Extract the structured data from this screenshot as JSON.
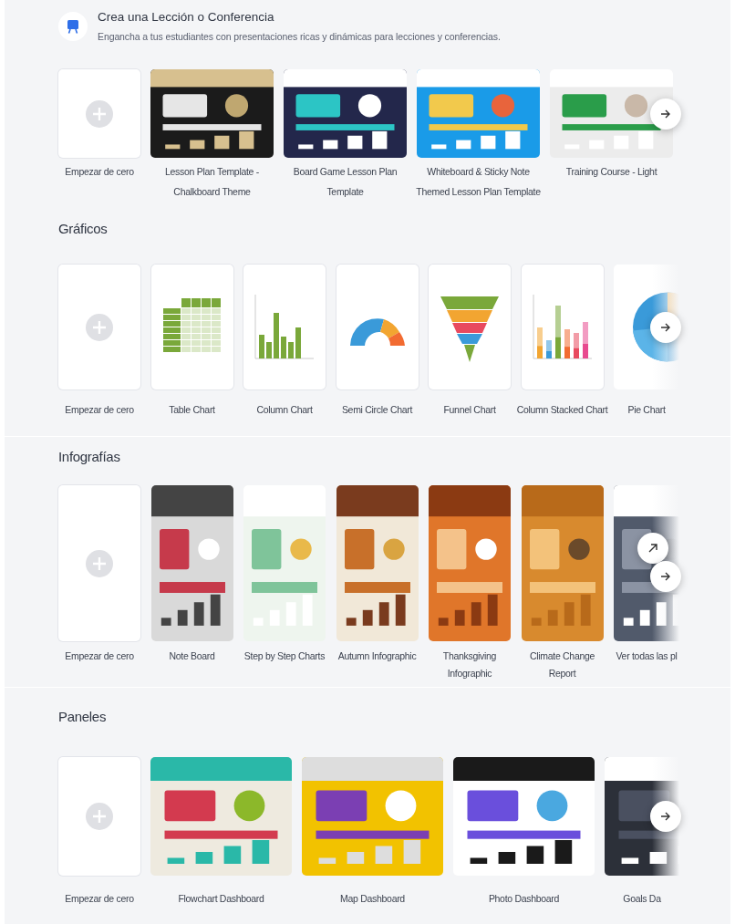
{
  "header": {
    "title": "Crea una Lección o Conferencia",
    "subtitle": "Engancha a tus estudiantes con presentaciones ricas y dinámicas para lecciones y conferencias."
  },
  "sections": [
    {
      "kind": "landscape",
      "cards": [
        {
          "kind": "blank",
          "label": "Empezar de cero"
        },
        {
          "kind": "picture",
          "label": "Lesson Plan Template - Chalkboard Theme"
        },
        {
          "kind": "picture",
          "label": "Board Game Lesson Plan Template"
        },
        {
          "kind": "picture",
          "label": "Whiteboard & Sticky Note Themed Lesson Plan Template"
        },
        {
          "kind": "picture",
          "label": "Training Course - Light"
        }
      ],
      "nav_buttons": [
        {
          "kind": "next"
        }
      ]
    },
    {
      "kind": "portrait",
      "title": "Gráficos",
      "cards": [
        {
          "kind": "blank",
          "label": "Empezar de cero"
        },
        {
          "kind": "table",
          "label": "Table Chart"
        },
        {
          "kind": "column",
          "label": "Column Chart"
        },
        {
          "kind": "semicircle",
          "label": "Semi Circle Chart"
        },
        {
          "kind": "funnel",
          "label": "Funnel Chart"
        },
        {
          "kind": "stacked",
          "label": "Column Stacked Chart"
        },
        {
          "kind": "pie",
          "label": "Pie Chart"
        }
      ],
      "nav_buttons": [
        {
          "kind": "next"
        }
      ]
    },
    {
      "kind": "tall",
      "title": "Infografías",
      "cards": [
        {
          "kind": "blank",
          "label": "Empezar de cero"
        },
        {
          "kind": "picture",
          "label": "Note Board"
        },
        {
          "kind": "picture",
          "label": "Step by Step Charts"
        },
        {
          "kind": "picture",
          "label": "Autumn Infographic"
        },
        {
          "kind": "picture",
          "label": "Thanksgiving Infographic"
        },
        {
          "kind": "picture",
          "label": "Climate Change Report"
        },
        {
          "kind": "picture",
          "label": "Ver todas las pl"
        }
      ],
      "nav_buttons": [
        {
          "kind": "external"
        },
        {
          "kind": "next"
        }
      ]
    },
    {
      "kind": "wide",
      "title": "Paneles",
      "cards": [
        {
          "kind": "blank",
          "label": "Empezar de cero"
        },
        {
          "kind": "picture",
          "label": "Flowchart Dashboard"
        },
        {
          "kind": "picture",
          "label": "Map Dashboard"
        },
        {
          "kind": "picture",
          "label": "Photo Dashboard"
        },
        {
          "kind": "picture",
          "label": "Goals Da"
        }
      ],
      "nav_buttons": [
        {
          "kind": "next"
        }
      ]
    }
  ]
}
